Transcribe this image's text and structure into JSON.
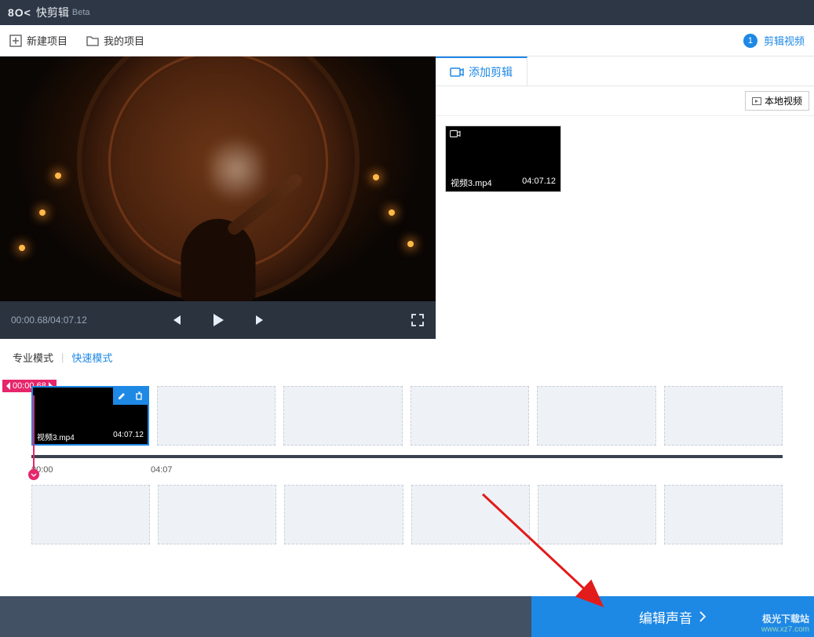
{
  "titlebar": {
    "logo": "8O<",
    "app_name": "快剪辑",
    "beta": "Beta"
  },
  "toolbar": {
    "new_project": "新建项目",
    "my_projects": "我的项目",
    "step_number": "1",
    "step_label": "剪辑视频"
  },
  "player": {
    "time_display": "00:00.68/04:07.12"
  },
  "side_panel": {
    "tab_add_clip": "添加剪辑",
    "local_video_btn": "本地视频",
    "clip": {
      "filename": "视频3.mp4",
      "duration": "04:07.12"
    }
  },
  "mode_bar": {
    "pro_mode": "专业模式",
    "fast_mode": "快速模式"
  },
  "timeline": {
    "playhead_time": "00:00.68",
    "clip": {
      "filename": "视频3.mp4",
      "duration": "04:07.12"
    },
    "ruler_ticks": [
      "00:00",
      "04:07"
    ]
  },
  "bottom": {
    "edit_audio": "编辑声音"
  },
  "watermark": {
    "line1": "极光下载站",
    "line2": "www.xz7.com"
  }
}
